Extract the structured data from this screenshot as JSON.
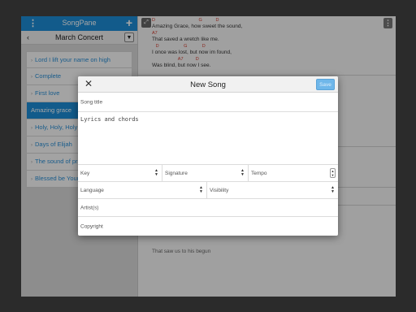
{
  "sidebar": {
    "app_title": "SongPane",
    "menu_icon": "⋮",
    "add_icon": "+",
    "back_icon": "‹",
    "set_title": "March Concert",
    "set_dropdown_icon": "▼",
    "items": [
      {
        "label": "Lord I lift your name on high"
      },
      {
        "label": "Complete"
      },
      {
        "label": "First love"
      },
      {
        "label": "Amazing grace"
      },
      {
        "label": "Holy, Holy, Holy"
      },
      {
        "label": "Days of Elijah"
      },
      {
        "label": "The sound of praise"
      },
      {
        "label": "Blessed be Your name"
      }
    ],
    "item_chevron": "›"
  },
  "song_view": {
    "lines": [
      {
        "chords": "D                                   G           D",
        "lyric": "Amazing Grace, how sweet the sound,"
      },
      {
        "chords": "A7",
        "lyric": "That saved a wretch like me."
      },
      {
        "chords": "   D                    G            D",
        "lyric": "I once was lost, but now im found,"
      },
      {
        "chords": "                     A7          D",
        "lyric": "Was blind, but now I see."
      }
    ],
    "hidden_line": "That saw us to his begun"
  },
  "modal": {
    "close_icon": "✕",
    "title": "New Song",
    "save_label": "Save",
    "song_title_placeholder": "Song title",
    "lyrics_placeholder": "Lyrics and chords",
    "key_label": "Key",
    "signature_label": "Signature",
    "tempo_label": "Tempo",
    "language_label": "Language",
    "visibility_label": "Visibility",
    "artist_placeholder": "Artist(s)",
    "copyright_placeholder": "Copyright"
  },
  "colors": {
    "accent": "#1d8dd6",
    "chord": "#d23b2e"
  }
}
